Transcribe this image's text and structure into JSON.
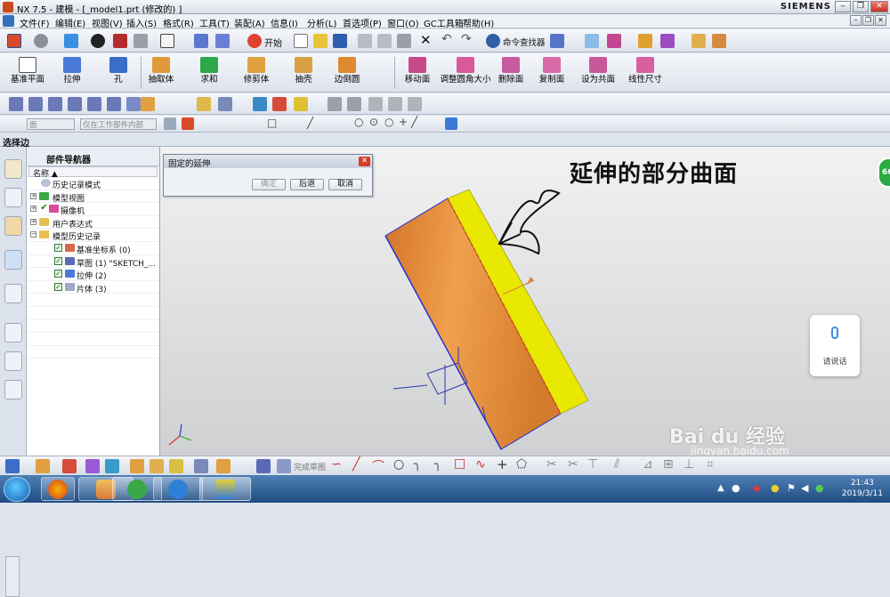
{
  "window": {
    "app_title": "NX 7.5 - 建模 - [_model1.prt  (修改的) ]",
    "brand": "SIEMENS"
  },
  "menu": [
    "文件(F)",
    "编辑(E)",
    "视图(V)",
    "插入(S)",
    "格式(R)",
    "工具(T)",
    "装配(A)",
    "信息(I)",
    "分析(L)",
    "首选项(P)",
    "窗口(O)",
    "GC工具箱",
    "帮助(H)"
  ],
  "toolbar1": {
    "start_label": "开始",
    "cmd_finder_label": "命令查找器"
  },
  "feature_toolbar": [
    "基准平面",
    "拉伸",
    "孔",
    "抽取体",
    "求和",
    "修剪体",
    "抽壳",
    "边倒圆",
    "移动面",
    "调整圆角大小",
    "删除面",
    "复制面",
    "设为共面",
    "线性尺寸"
  ],
  "selection_bar": {
    "filter_value": "面",
    "scope_value": "仅在工作部件内部"
  },
  "status": "选择边",
  "navigator": {
    "title": "部件导航器",
    "column": "名称",
    "rows": [
      {
        "label": "历史记录模式",
        "indent": 1
      },
      {
        "label": "模型视图",
        "indent": 0
      },
      {
        "label": "摄像机",
        "indent": 0
      },
      {
        "label": "用户表达式",
        "indent": 0
      },
      {
        "label": "模型历史记录",
        "indent": 0
      },
      {
        "label": "基准坐标系 (0)",
        "indent": 2
      },
      {
        "label": "草图 (1) \"SKETCH_...",
        "indent": 2
      },
      {
        "label": "拉伸 (2)",
        "indent": 2
      },
      {
        "label": "片体 (3)",
        "indent": 2
      }
    ]
  },
  "dialog": {
    "title": "固定的延伸",
    "ok_label": "确定",
    "back_label": "后退",
    "cancel_label": "取消"
  },
  "annotation": "延伸的部分曲面",
  "voice_widget": {
    "label": "请说话"
  },
  "badge": "66",
  "bottom_toolbar": {
    "sketch_finish_label": "完成草图"
  },
  "watermark": {
    "brand": "Bai du 经验",
    "url": "jingyan.baidu.com"
  },
  "taskbar": {
    "time": "21:43",
    "date": "2019/3/11"
  },
  "colors": {
    "body_face": "#e8902f",
    "extension_face": "#e8e800",
    "edge": "#1f2fd0",
    "selection_highlight": "#d83a22"
  }
}
